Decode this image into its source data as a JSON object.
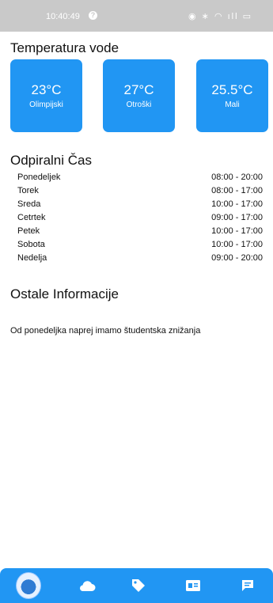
{
  "status": {
    "time": "10:40:49",
    "alert_glyph": "?",
    "icons_text": "◉ ∗ ◠ ıll ▭"
  },
  "temperatures": {
    "title": "Temperatura vode",
    "items": [
      {
        "value": "23°C",
        "name": "Olimpijski"
      },
      {
        "value": "27°C",
        "name": "Otroški"
      },
      {
        "value": "25.5°C",
        "name": "Mali"
      }
    ]
  },
  "hours": {
    "title": "Odpiralni Čas",
    "rows": [
      {
        "day": "Ponedeljek",
        "time": "08:00 - 20:00"
      },
      {
        "day": "Torek",
        "time": "08:00 - 17:00"
      },
      {
        "day": "Sreda",
        "time": "10:00 - 17:00"
      },
      {
        "day": "Cetrtek",
        "time": "09:00 - 17:00"
      },
      {
        "day": "Petek",
        "time": "10:00 - 17:00"
      },
      {
        "day": "Sobota",
        "time": "10:00 - 17:00"
      },
      {
        "day": "Nedelja",
        "time": "09:00 - 20:00"
      }
    ]
  },
  "info": {
    "title": "Ostale Informacije",
    "text": "Od ponedeljka naprej imamo študentska znižanja"
  },
  "nav": {
    "items": [
      "mascot-logo",
      "cloud-icon",
      "tag-icon",
      "contact-card-icon",
      "chat-icon"
    ]
  },
  "colors": {
    "accent": "#2196f3",
    "statusbar": "#c9c9c9"
  }
}
